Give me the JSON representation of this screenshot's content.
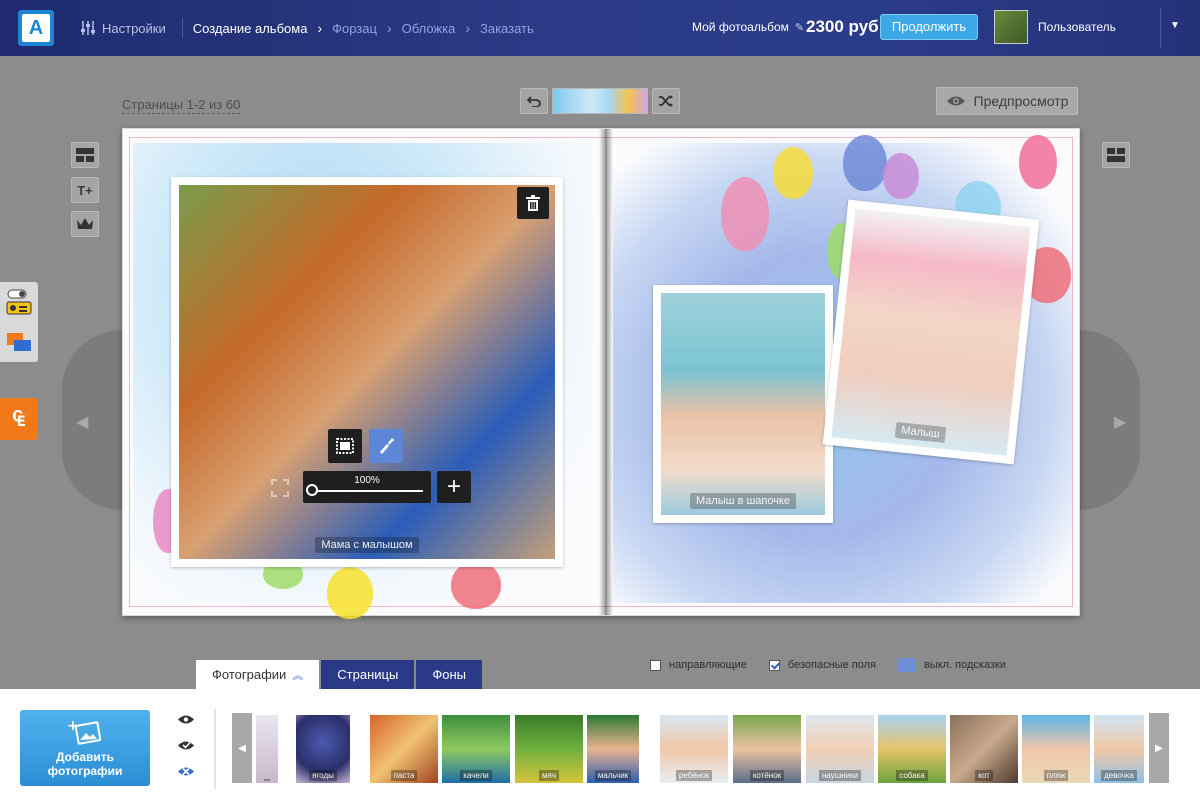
{
  "header": {
    "logo": "A",
    "settings_label": "Настройки",
    "steps": [
      "Создание альбома",
      "Форзац",
      "Обложка",
      "Заказать"
    ],
    "album_name": "Мой фотоальбом",
    "price": "2300 руб",
    "continue_label": "Продолжить",
    "user_name": "Пользователь"
  },
  "workspace": {
    "pages_info": "Страницы 1-2 из 60",
    "preview_label": "Предпросмотр",
    "zoom_pct": "100%"
  },
  "photos_on_page": [
    {
      "caption": "Мама с малышом"
    },
    {
      "caption": "Малыш в шапочке"
    },
    {
      "caption": "Малыш"
    }
  ],
  "bottom": {
    "tabs": [
      "Фотографии",
      "Страницы",
      "Фоны"
    ],
    "options": [
      {
        "label": "направляющие",
        "checked": false
      },
      {
        "label": "безопасные поля",
        "checked": true
      },
      {
        "label": "выкл. подсказки"
      }
    ],
    "add_photos_label_1": "Добавить",
    "add_photos_label_2": "фотографии",
    "thumbs": [
      {
        "label": ""
      },
      {
        "label": "ягоды"
      },
      {
        "label": "паста"
      },
      {
        "label": "качели"
      },
      {
        "label": "мяч"
      },
      {
        "label": "мальчик"
      },
      {
        "label": "ребёнок"
      },
      {
        "label": "котёнок"
      },
      {
        "label": "наушники"
      },
      {
        "label": "собака"
      },
      {
        "label": "кот"
      },
      {
        "label": "пляж"
      },
      {
        "label": "девочка"
      }
    ]
  },
  "colors": {
    "header_bg": "#25327a",
    "accent": "#3ca9e6",
    "orange": "#f07a1a",
    "tab_bg": "#2b3a88"
  }
}
